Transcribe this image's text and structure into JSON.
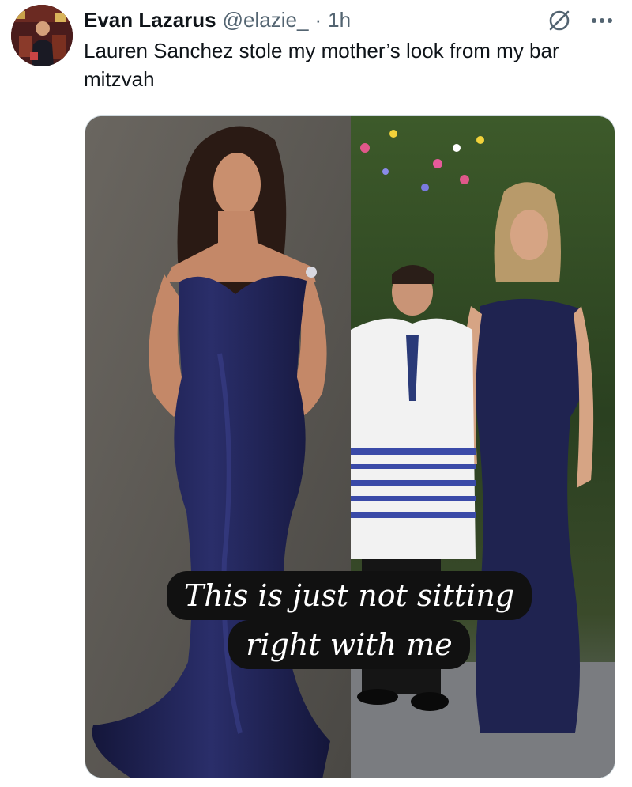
{
  "author": {
    "display_name": "Evan Lazarus",
    "handle": "@elazie_",
    "separator": "·",
    "timestamp": "1h"
  },
  "tweet": {
    "text": "Lauren Sanchez stole my mother’s look from my bar mitzvah"
  },
  "media": {
    "caption_line_1": "This is just not sitting",
    "caption_line_2": "right with me"
  },
  "icons": {
    "grok": "grok-icon",
    "more": "more-options-icon"
  },
  "colors": {
    "text_primary": "#0f1419",
    "text_secondary": "#536471",
    "dress_navy": "#1c1f45"
  }
}
